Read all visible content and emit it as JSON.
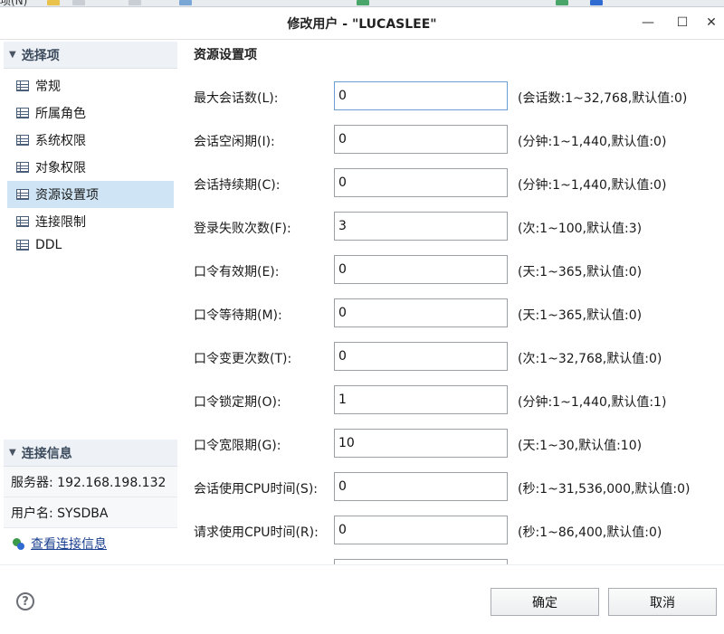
{
  "window": {
    "title": "修改用户 - \"LUCASLEE\"",
    "minimize_glyph": "—",
    "maximize_glyph": "☐",
    "close_glyph": "✕"
  },
  "left_panel": {
    "section_title": "选择项",
    "items": [
      {
        "label": "常规",
        "selected": false
      },
      {
        "label": "所属角色",
        "selected": false
      },
      {
        "label": "系统权限",
        "selected": false
      },
      {
        "label": "对象权限",
        "selected": false
      },
      {
        "label": "资源设置项",
        "selected": true
      },
      {
        "label": "连接限制",
        "selected": false
      },
      {
        "label": "DDL",
        "selected": false
      }
    ],
    "connection": {
      "section_title": "连接信息",
      "server": "服务器: 192.168.198.132",
      "user": "用户名: SYSDBA",
      "view_link": "查看连接信息"
    }
  },
  "content": {
    "title": "资源设置项",
    "fields": [
      {
        "label": "最大会话数(L):",
        "value": "0",
        "hint": "(会话数:1~32,768,默认值:0)"
      },
      {
        "label": "会话空闲期(I):",
        "value": "0",
        "hint": "(分钟:1~1,440,默认值:0)"
      },
      {
        "label": "会话持续期(C):",
        "value": "0",
        "hint": "(分钟:1~1,440,默认值:0)"
      },
      {
        "label": "登录失败次数(F):",
        "value": "3",
        "hint": "(次:1~100,默认值:3)"
      },
      {
        "label": "口令有效期(E):",
        "value": "0",
        "hint": "(天:1~365,默认值:0)"
      },
      {
        "label": "口令等待期(M):",
        "value": "0",
        "hint": "(天:1~365,默认值:0)"
      },
      {
        "label": "口令变更次数(T):",
        "value": "0",
        "hint": "(次:1~32,768,默认值:0)"
      },
      {
        "label": "口令锁定期(O):",
        "value": "1",
        "hint": "(分钟:1~1,440,默认值:1)"
      },
      {
        "label": "口令宽限期(G):",
        "value": "10",
        "hint": "(天:1~30,默认值:10)"
      },
      {
        "label": "会话使用CPU时间(S):",
        "value": "0",
        "hint": "(秒:1~31,536,000,默认值:0)"
      },
      {
        "label": "请求使用CPU时间(R):",
        "value": "0",
        "hint": "(秒:1~86,400,默认值:0)"
      },
      {
        "label": "",
        "value": "",
        "hint": ""
      }
    ]
  },
  "buttons": {
    "help_glyph": "?",
    "ok": "确定",
    "cancel": "取消"
  },
  "app_toolbar": {
    "fragment": "项(N)"
  }
}
